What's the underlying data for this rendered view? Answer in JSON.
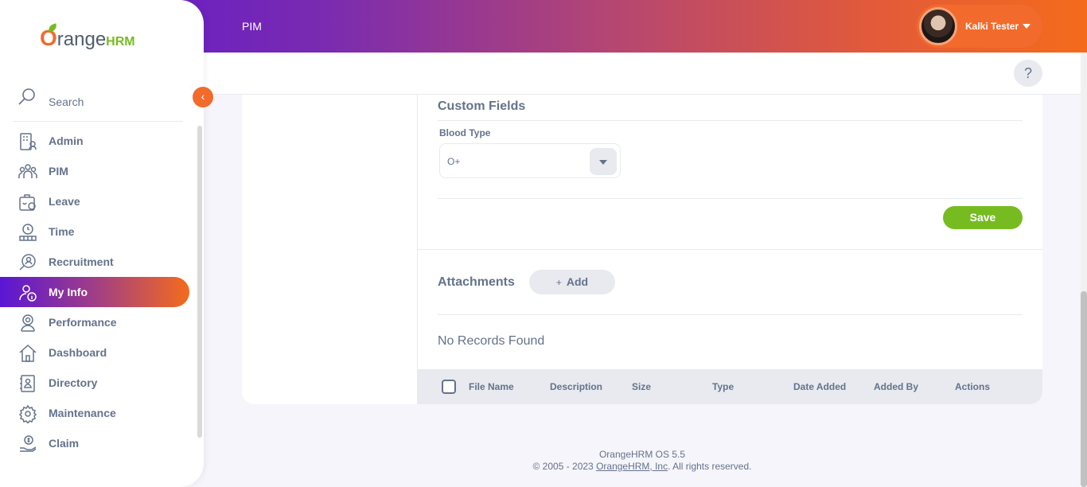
{
  "header": {
    "module_title": "PIM",
    "user_name": "Kalki Tester",
    "help_label": "?"
  },
  "sidebar": {
    "brand_main": "range",
    "brand_o": "O",
    "brand_hrm": "HRM",
    "search_label": "Search",
    "collapse_label": "‹",
    "items": [
      {
        "label": "Admin",
        "icon": "admin-icon"
      },
      {
        "label": "PIM",
        "icon": "pim-icon"
      },
      {
        "label": "Leave",
        "icon": "leave-icon"
      },
      {
        "label": "Time",
        "icon": "time-icon"
      },
      {
        "label": "Recruitment",
        "icon": "recruitment-icon"
      },
      {
        "label": "My Info",
        "icon": "my-info-icon",
        "active": true
      },
      {
        "label": "Performance",
        "icon": "performance-icon"
      },
      {
        "label": "Dashboard",
        "icon": "dashboard-icon"
      },
      {
        "label": "Directory",
        "icon": "directory-icon"
      },
      {
        "label": "Maintenance",
        "icon": "maintenance-icon"
      },
      {
        "label": "Claim",
        "icon": "claim-icon"
      }
    ]
  },
  "custom_fields": {
    "title": "Custom Fields",
    "blood_type_label": "Blood Type",
    "blood_type_value": "O+",
    "save_label": "Save"
  },
  "attachments": {
    "title": "Attachments",
    "add_label": "Add",
    "add_icon": "+",
    "empty_text": "No Records Found",
    "columns": [
      "File Name",
      "Description",
      "Size",
      "Type",
      "Date Added",
      "Added By",
      "Actions"
    ]
  },
  "footer": {
    "version": "OrangeHRM OS 5.5",
    "copyright_prefix": "© 2005 - 2023 ",
    "company_link": "OrangeHRM, Inc",
    "copyright_suffix": ". All rights reserved."
  },
  "colors": {
    "accent_orange": "#f26b2c",
    "accent_green": "#76bc21",
    "gradient_start": "#5a16d4",
    "text": "#64728c"
  }
}
